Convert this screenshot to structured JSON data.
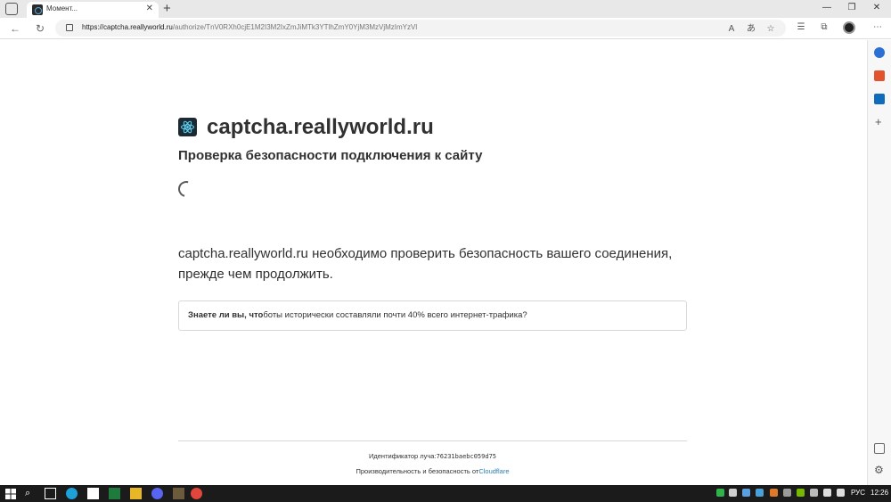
{
  "browser": {
    "tab_title": "Момент...",
    "url_host": "https://captcha.reallyworld.ru",
    "url_path": "/authorize/TnV0RXh0cjE1M2I3M2IxZmJiMTk3YTlhZmY0YjM3MzVjMzImYzVl"
  },
  "page": {
    "site_title": "captcha.reallyworld.ru",
    "subtitle": "Проверка безопасности подключения к сайту",
    "description": "captcha.reallyworld.ru необходимо проверить безопасность вашего соединения, прежде чем продолжить.",
    "info_bold": "Знаете ли вы, что",
    "info_rest": "боты исторически составляли почти 40% всего интернет-трафика?",
    "ray_label": "Идентификатор луча:",
    "ray_id": "76231baebc059d75",
    "performance_label": "Производительность и безопасность от",
    "performance_link": "Cloudflare"
  },
  "taskbar": {
    "lang": "РУС",
    "time": "12:26"
  },
  "colors": {
    "link": "#2c7cb0",
    "text": "#313131"
  }
}
